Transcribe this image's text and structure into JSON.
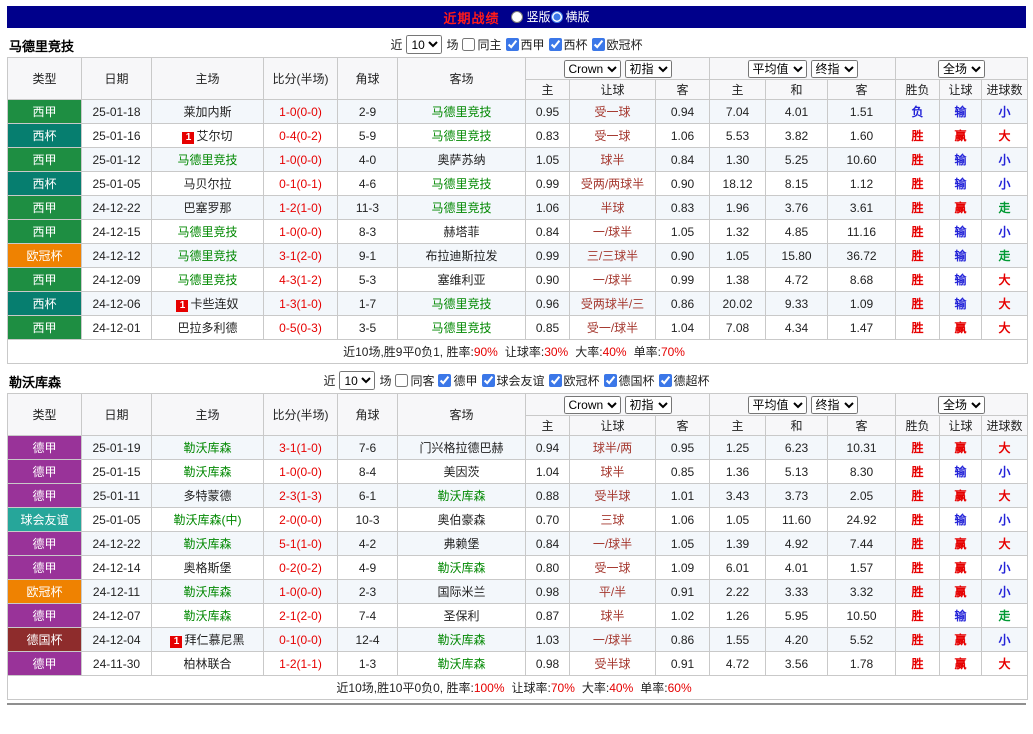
{
  "topbar": {
    "title": "近期战绩",
    "options": [
      {
        "label": "竖版",
        "selected": false
      },
      {
        "label": "横版",
        "selected": true
      }
    ]
  },
  "palette": {
    "topbar_bg": "#00008B",
    "league_colors": {
      "西甲": "#1E8E42",
      "西杯": "#067E6F",
      "欧冠杯": "#EF8201",
      "德甲": "#993399",
      "球会友谊": "#26A69A",
      "德国杯": "#8E2C2C"
    },
    "result_colors": {
      "r": "#E60000",
      "b": "#2323D8",
      "g": "#009933"
    },
    "focus_team_color": "#008800",
    "score_color": "#E60000",
    "handicap_color": "#A5382F"
  },
  "header": {
    "left_cols": [
      "类型",
      "日期",
      "主场",
      "比分(半场)",
      "角球",
      "客场"
    ],
    "groups": [
      {
        "selects": [
          "Crown",
          "初指"
        ],
        "subcols": [
          "主",
          "让球",
          "客"
        ]
      },
      {
        "selects": [
          "平均值",
          "终指"
        ],
        "subcols": [
          "主",
          "和",
          "客"
        ]
      },
      {
        "selects": [
          "全场"
        ],
        "subcols": [
          "胜负",
          "让球",
          "进球数"
        ]
      }
    ]
  },
  "sections": [
    {
      "team": "马德里竞技",
      "filter": {
        "near_label": "近",
        "count": "10",
        "unit_label": "场",
        "checkboxes": [
          {
            "label": "同主",
            "checked": false
          },
          {
            "label": "西甲",
            "checked": true
          },
          {
            "label": "西杯",
            "checked": true
          },
          {
            "label": "欧冠杯",
            "checked": true
          }
        ]
      },
      "rows": [
        {
          "league": "西甲",
          "date": "25-01-18",
          "home": "莱加内斯",
          "home_focus": false,
          "score": "1-0(0-0)",
          "corners": "2-9",
          "away": "马德里竞技",
          "away_focus": true,
          "odds1": [
            "0.95",
            "受一球",
            "0.94"
          ],
          "odds2": [
            "7.04",
            "4.01",
            "1.51"
          ],
          "results": [
            [
              "负",
              "b"
            ],
            [
              "输",
              "b"
            ],
            [
              "小",
              "b"
            ]
          ]
        },
        {
          "league": "西杯",
          "date": "25-01-16",
          "home": "艾尔切",
          "home_badge": "1",
          "home_focus": false,
          "score": "0-4(0-2)",
          "corners": "5-9",
          "away": "马德里竞技",
          "away_focus": true,
          "odds1": [
            "0.83",
            "受一球",
            "1.06"
          ],
          "odds2": [
            "5.53",
            "3.82",
            "1.60"
          ],
          "results": [
            [
              "胜",
              "r"
            ],
            [
              "赢",
              "r"
            ],
            [
              "大",
              "r"
            ]
          ]
        },
        {
          "league": "西甲",
          "date": "25-01-12",
          "home": "马德里竞技",
          "home_focus": true,
          "score": "1-0(0-0)",
          "corners": "4-0",
          "away": "奥萨苏纳",
          "away_focus": false,
          "odds1": [
            "1.05",
            "球半",
            "0.84"
          ],
          "odds2": [
            "1.30",
            "5.25",
            "10.60"
          ],
          "results": [
            [
              "胜",
              "r"
            ],
            [
              "输",
              "b"
            ],
            [
              "小",
              "b"
            ]
          ]
        },
        {
          "league": "西杯",
          "date": "25-01-05",
          "home": "马贝尔拉",
          "home_focus": false,
          "score": "0-1(0-1)",
          "corners": "4-6",
          "away": "马德里竞技",
          "away_focus": true,
          "odds1": [
            "0.99",
            "受两/两球半",
            "0.90"
          ],
          "odds2": [
            "18.12",
            "8.15",
            "1.12"
          ],
          "results": [
            [
              "胜",
              "r"
            ],
            [
              "输",
              "b"
            ],
            [
              "小",
              "b"
            ]
          ]
        },
        {
          "league": "西甲",
          "date": "24-12-22",
          "home": "巴塞罗那",
          "home_focus": false,
          "score": "1-2(1-0)",
          "corners": "11-3",
          "away": "马德里竞技",
          "away_focus": true,
          "odds1": [
            "1.06",
            "半球",
            "0.83"
          ],
          "odds2": [
            "1.96",
            "3.76",
            "3.61"
          ],
          "results": [
            [
              "胜",
              "r"
            ],
            [
              "赢",
              "r"
            ],
            [
              "走",
              "g"
            ]
          ]
        },
        {
          "league": "西甲",
          "date": "24-12-15",
          "home": "马德里竞技",
          "home_focus": true,
          "score": "1-0(0-0)",
          "corners": "8-3",
          "away": "赫塔菲",
          "away_focus": false,
          "odds1": [
            "0.84",
            "一/球半",
            "1.05"
          ],
          "odds2": [
            "1.32",
            "4.85",
            "11.16"
          ],
          "results": [
            [
              "胜",
              "r"
            ],
            [
              "输",
              "b"
            ],
            [
              "小",
              "b"
            ]
          ]
        },
        {
          "league": "欧冠杯",
          "date": "24-12-12",
          "home": "马德里竞技",
          "home_focus": true,
          "score": "3-1(2-0)",
          "corners": "9-1",
          "away": "布拉迪斯拉发",
          "away_focus": false,
          "odds1": [
            "0.99",
            "三/三球半",
            "0.90"
          ],
          "odds2": [
            "1.05",
            "15.80",
            "36.72"
          ],
          "results": [
            [
              "胜",
              "r"
            ],
            [
              "输",
              "b"
            ],
            [
              "走",
              "g"
            ]
          ]
        },
        {
          "league": "西甲",
          "date": "24-12-09",
          "home": "马德里竞技",
          "home_focus": true,
          "score": "4-3(1-2)",
          "corners": "5-3",
          "away": "塞维利亚",
          "away_focus": false,
          "odds1": [
            "0.90",
            "一/球半",
            "0.99"
          ],
          "odds2": [
            "1.38",
            "4.72",
            "8.68"
          ],
          "results": [
            [
              "胜",
              "r"
            ],
            [
              "输",
              "b"
            ],
            [
              "大",
              "r"
            ]
          ]
        },
        {
          "league": "西杯",
          "date": "24-12-06",
          "home": "卡些连奴",
          "home_badge": "1",
          "home_focus": false,
          "score": "1-3(1-0)",
          "corners": "1-7",
          "away": "马德里竞技",
          "away_focus": true,
          "odds1": [
            "0.96",
            "受两球半/三",
            "0.86"
          ],
          "odds2": [
            "20.02",
            "9.33",
            "1.09"
          ],
          "results": [
            [
              "胜",
              "r"
            ],
            [
              "输",
              "b"
            ],
            [
              "大",
              "r"
            ]
          ]
        },
        {
          "league": "西甲",
          "date": "24-12-01",
          "home": "巴拉多利德",
          "home_focus": false,
          "score": "0-5(0-3)",
          "corners": "3-5",
          "away": "马德里竞技",
          "away_focus": true,
          "odds1": [
            "0.85",
            "受一/球半",
            "1.04"
          ],
          "odds2": [
            "7.08",
            "4.34",
            "1.47"
          ],
          "results": [
            [
              "胜",
              "r"
            ],
            [
              "赢",
              "r"
            ],
            [
              "大",
              "r"
            ]
          ]
        }
      ],
      "summary": {
        "prefix": "近10场,胜9平0负1, ",
        "stats": [
          {
            "label": "胜率:",
            "value": "90%"
          },
          {
            "label": "让球率:",
            "value": "30%"
          },
          {
            "label": "大率:",
            "value": "40%"
          },
          {
            "label": "单率:",
            "value": "70%"
          }
        ]
      }
    },
    {
      "team": "勒沃库森",
      "filter": {
        "near_label": "近",
        "count": "10",
        "unit_label": "场",
        "checkboxes": [
          {
            "label": "同客",
            "checked": false
          },
          {
            "label": "德甲",
            "checked": true
          },
          {
            "label": "球会友谊",
            "checked": true
          },
          {
            "label": "欧冠杯",
            "checked": true
          },
          {
            "label": "德国杯",
            "checked": true
          },
          {
            "label": "德超杯",
            "checked": true
          }
        ]
      },
      "rows": [
        {
          "league": "德甲",
          "date": "25-01-19",
          "home": "勒沃库森",
          "home_focus": true,
          "score": "3-1(1-0)",
          "corners": "7-6",
          "away": "门兴格拉德巴赫",
          "away_focus": false,
          "odds1": [
            "0.94",
            "球半/两",
            "0.95"
          ],
          "odds2": [
            "1.25",
            "6.23",
            "10.31"
          ],
          "results": [
            [
              "胜",
              "r"
            ],
            [
              "赢",
              "r"
            ],
            [
              "大",
              "r"
            ]
          ]
        },
        {
          "league": "德甲",
          "date": "25-01-15",
          "home": "勒沃库森",
          "home_focus": true,
          "score": "1-0(0-0)",
          "corners": "8-4",
          "away": "美因茨",
          "away_focus": false,
          "odds1": [
            "1.04",
            "球半",
            "0.85"
          ],
          "odds2": [
            "1.36",
            "5.13",
            "8.30"
          ],
          "results": [
            [
              "胜",
              "r"
            ],
            [
              "输",
              "b"
            ],
            [
              "小",
              "b"
            ]
          ]
        },
        {
          "league": "德甲",
          "date": "25-01-11",
          "home": "多特蒙德",
          "home_focus": false,
          "score": "2-3(1-3)",
          "corners": "6-1",
          "away": "勒沃库森",
          "away_focus": true,
          "odds1": [
            "0.88",
            "受半球",
            "1.01"
          ],
          "odds2": [
            "3.43",
            "3.73",
            "2.05"
          ],
          "results": [
            [
              "胜",
              "r"
            ],
            [
              "赢",
              "r"
            ],
            [
              "大",
              "r"
            ]
          ]
        },
        {
          "league": "球会友谊",
          "date": "25-01-05",
          "home": "勒沃库森(中)",
          "home_focus": true,
          "score": "2-0(0-0)",
          "corners": "10-3",
          "away": "奥伯豪森",
          "away_focus": false,
          "odds1": [
            "0.70",
            "三球",
            "1.06"
          ],
          "odds2": [
            "1.05",
            "11.60",
            "24.92"
          ],
          "results": [
            [
              "胜",
              "r"
            ],
            [
              "输",
              "b"
            ],
            [
              "小",
              "b"
            ]
          ]
        },
        {
          "league": "德甲",
          "date": "24-12-22",
          "home": "勒沃库森",
          "home_focus": true,
          "score": "5-1(1-0)",
          "corners": "4-2",
          "away": "弗赖堡",
          "away_focus": false,
          "odds1": [
            "0.84",
            "一/球半",
            "1.05"
          ],
          "odds2": [
            "1.39",
            "4.92",
            "7.44"
          ],
          "results": [
            [
              "胜",
              "r"
            ],
            [
              "赢",
              "r"
            ],
            [
              "大",
              "r"
            ]
          ]
        },
        {
          "league": "德甲",
          "date": "24-12-14",
          "home": "奥格斯堡",
          "home_focus": false,
          "score": "0-2(0-2)",
          "corners": "4-9",
          "away": "勒沃库森",
          "away_focus": true,
          "odds1": [
            "0.80",
            "受一球",
            "1.09"
          ],
          "odds2": [
            "6.01",
            "4.01",
            "1.57"
          ],
          "results": [
            [
              "胜",
              "r"
            ],
            [
              "赢",
              "r"
            ],
            [
              "小",
              "b"
            ]
          ]
        },
        {
          "league": "欧冠杯",
          "date": "24-12-11",
          "home": "勒沃库森",
          "home_focus": true,
          "score": "1-0(0-0)",
          "corners": "2-3",
          "away": "国际米兰",
          "away_focus": false,
          "odds1": [
            "0.98",
            "平/半",
            "0.91"
          ],
          "odds2": [
            "2.22",
            "3.33",
            "3.32"
          ],
          "results": [
            [
              "胜",
              "r"
            ],
            [
              "赢",
              "r"
            ],
            [
              "小",
              "b"
            ]
          ]
        },
        {
          "league": "德甲",
          "date": "24-12-07",
          "home": "勒沃库森",
          "home_focus": true,
          "score": "2-1(2-0)",
          "corners": "7-4",
          "away": "圣保利",
          "away_focus": false,
          "odds1": [
            "0.87",
            "球半",
            "1.02"
          ],
          "odds2": [
            "1.26",
            "5.95",
            "10.50"
          ],
          "results": [
            [
              "胜",
              "r"
            ],
            [
              "输",
              "b"
            ],
            [
              "走",
              "g"
            ]
          ]
        },
        {
          "league": "德国杯",
          "date": "24-12-04",
          "home": "拜仁慕尼黑",
          "home_badge": "1",
          "home_focus": false,
          "score": "0-1(0-0)",
          "corners": "12-4",
          "away": "勒沃库森",
          "away_focus": true,
          "odds1": [
            "1.03",
            "一/球半",
            "0.86"
          ],
          "odds2": [
            "1.55",
            "4.20",
            "5.52"
          ],
          "results": [
            [
              "胜",
              "r"
            ],
            [
              "赢",
              "r"
            ],
            [
              "小",
              "b"
            ]
          ]
        },
        {
          "league": "德甲",
          "date": "24-11-30",
          "home": "柏林联合",
          "home_focus": false,
          "score": "1-2(1-1)",
          "corners": "1-3",
          "away": "勒沃库森",
          "away_focus": true,
          "odds1": [
            "0.98",
            "受半球",
            "0.91"
          ],
          "odds2": [
            "4.72",
            "3.56",
            "1.78"
          ],
          "results": [
            [
              "胜",
              "r"
            ],
            [
              "赢",
              "r"
            ],
            [
              "大",
              "r"
            ]
          ]
        }
      ],
      "summary": {
        "prefix": "近10场,胜10平0负0, ",
        "stats": [
          {
            "label": "胜率:",
            "value": "100%"
          },
          {
            "label": "让球率:",
            "value": "70%"
          },
          {
            "label": "大率:",
            "value": "40%"
          },
          {
            "label": "单率:",
            "value": "60%"
          }
        ]
      }
    }
  ]
}
